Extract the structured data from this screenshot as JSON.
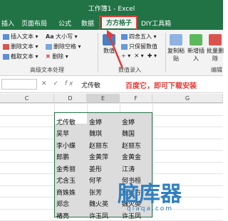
{
  "window": {
    "title": "工作簿1 - Excel"
  },
  "tabs": [
    {
      "label": "插入",
      "active": false
    },
    {
      "label": "页面布局",
      "active": false
    },
    {
      "label": "公式",
      "active": false
    },
    {
      "label": "数据",
      "active": false
    },
    {
      "label": "方方格子",
      "active": true
    },
    {
      "label": "DIY工具箱",
      "active": false
    }
  ],
  "ribbon": {
    "left_group": {
      "items": [
        "插入文本",
        "删除文本",
        "截取文本"
      ],
      "mid_items": [
        "大小写",
        "删除空格",
        "删除"
      ],
      "label": "高级文本处理"
    },
    "numeric_group": {
      "big_label": "数值",
      "items": [
        "四舍五入",
        "只保留数值"
      ],
      "label": "数值录入"
    },
    "right_group": {
      "buttons": [
        "复制粘贴",
        "新增插入",
        "批量删除"
      ],
      "label": "编辑"
    }
  },
  "formula_bar": {
    "fx": "fx",
    "value": "尤传敏",
    "annotation": "百度它，即可下载安装"
  },
  "grid": {
    "columns": [
      "C",
      "D",
      "E",
      "F",
      "G"
    ],
    "rows": [
      [
        "尤传敏",
        "金婷",
        "金婷"
      ],
      [
        "吴苹",
        "魏琪",
        "魏国"
      ],
      [
        "李小蝶",
        "赵丽东",
        "赵丽东"
      ],
      [
        "郎鹏",
        "金黄萍",
        "金黄金"
      ],
      [
        "金秀丽",
        "姜彤",
        "江涛"
      ],
      [
        "尤含玉",
        "何芊",
        "何书桓"
      ],
      [
        "商姝姝",
        "张芳",
        "张远方"
      ],
      [
        "郑念",
        "魏火英",
        "魏火英"
      ],
      [
        "褚亮",
        "许玉凤",
        "许玉凤"
      ]
    ]
  },
  "watermark": {
    "text": "脑库器",
    "url": "qiaqa.com"
  },
  "colors": {
    "excel_green": "#217346",
    "highlight_red": "#e53935",
    "watermark_blue": "#2f7fc1"
  }
}
